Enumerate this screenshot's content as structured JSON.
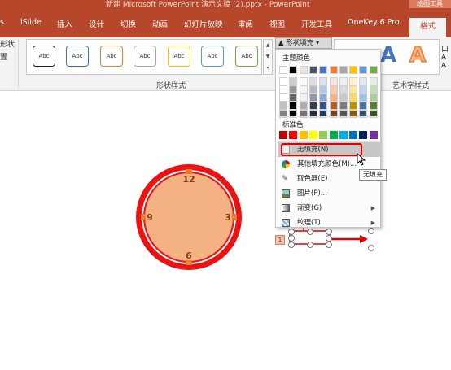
{
  "window": {
    "title": "新建 Microsoft PowerPoint 演示文稿 (2).pptx  -  PowerPoint",
    "drawing_tools": "绘图工具"
  },
  "ribbon_tabs": [
    "iSlide",
    "插入",
    "设计",
    "切换",
    "动画",
    "幻灯片放映",
    "审阅",
    "视图",
    "开发工具",
    "OneKey 6 Pro"
  ],
  "active_tab": "格式",
  "left_fragments": [
    "形状",
    "置"
  ],
  "shape_styles": {
    "swatch_label": "Abc",
    "swatch_colors": [
      "#222222",
      "#4472c4",
      "#ed7d31",
      "#a5a5a5",
      "#ffc000",
      "#5b9bd5",
      "#70ad47"
    ],
    "group_label": "形状样式"
  },
  "shape_fill_button": "形状填充",
  "wordart": {
    "letters": [
      "A",
      "A"
    ],
    "letter_colors": [
      "#4472c4",
      "#f4b183"
    ],
    "group_label": "艺术字样式"
  },
  "right_edge": [
    "口",
    "A",
    "A"
  ],
  "fill_menu": {
    "theme_heading": "主题颜色",
    "theme_colors": [
      "#ffffff",
      "#000000",
      "#e7e6e6",
      "#44546a",
      "#4472c4",
      "#ed7d31",
      "#a5a5a5",
      "#ffc000",
      "#5b9bd5",
      "#70ad47"
    ],
    "standard_heading": "标准色",
    "standard_colors": [
      "#c00000",
      "#ff0000",
      "#ffc000",
      "#ffff00",
      "#92d050",
      "#00b050",
      "#00b0f0",
      "#0070c0",
      "#002060",
      "#7030a0"
    ],
    "items": [
      {
        "label": "无填充(N)",
        "icon": "no-fill-icon",
        "highlighted": true,
        "submenu": false
      },
      {
        "label": "其他填充颜色(M)...",
        "icon": "palette-icon",
        "highlighted": false,
        "submenu": false
      },
      {
        "label": "取色器(E)",
        "icon": "eyedropper-icon",
        "highlighted": false,
        "submenu": false
      },
      {
        "label": "图片(P)...",
        "icon": "picture-icon",
        "highlighted": false,
        "submenu": false
      },
      {
        "label": "渐变(G)",
        "icon": "gradient-icon",
        "highlighted": false,
        "submenu": true
      },
      {
        "label": "纹理(T)",
        "icon": "texture-icon",
        "highlighted": false,
        "submenu": true
      }
    ]
  },
  "tooltip": "无填充",
  "clock": {
    "numbers": [
      "12",
      "3",
      "6",
      "9"
    ],
    "fill_color": "#f4b183",
    "ring_color": "#ee1111",
    "tick_color": "#ed7d31"
  },
  "slide_number": "1"
}
